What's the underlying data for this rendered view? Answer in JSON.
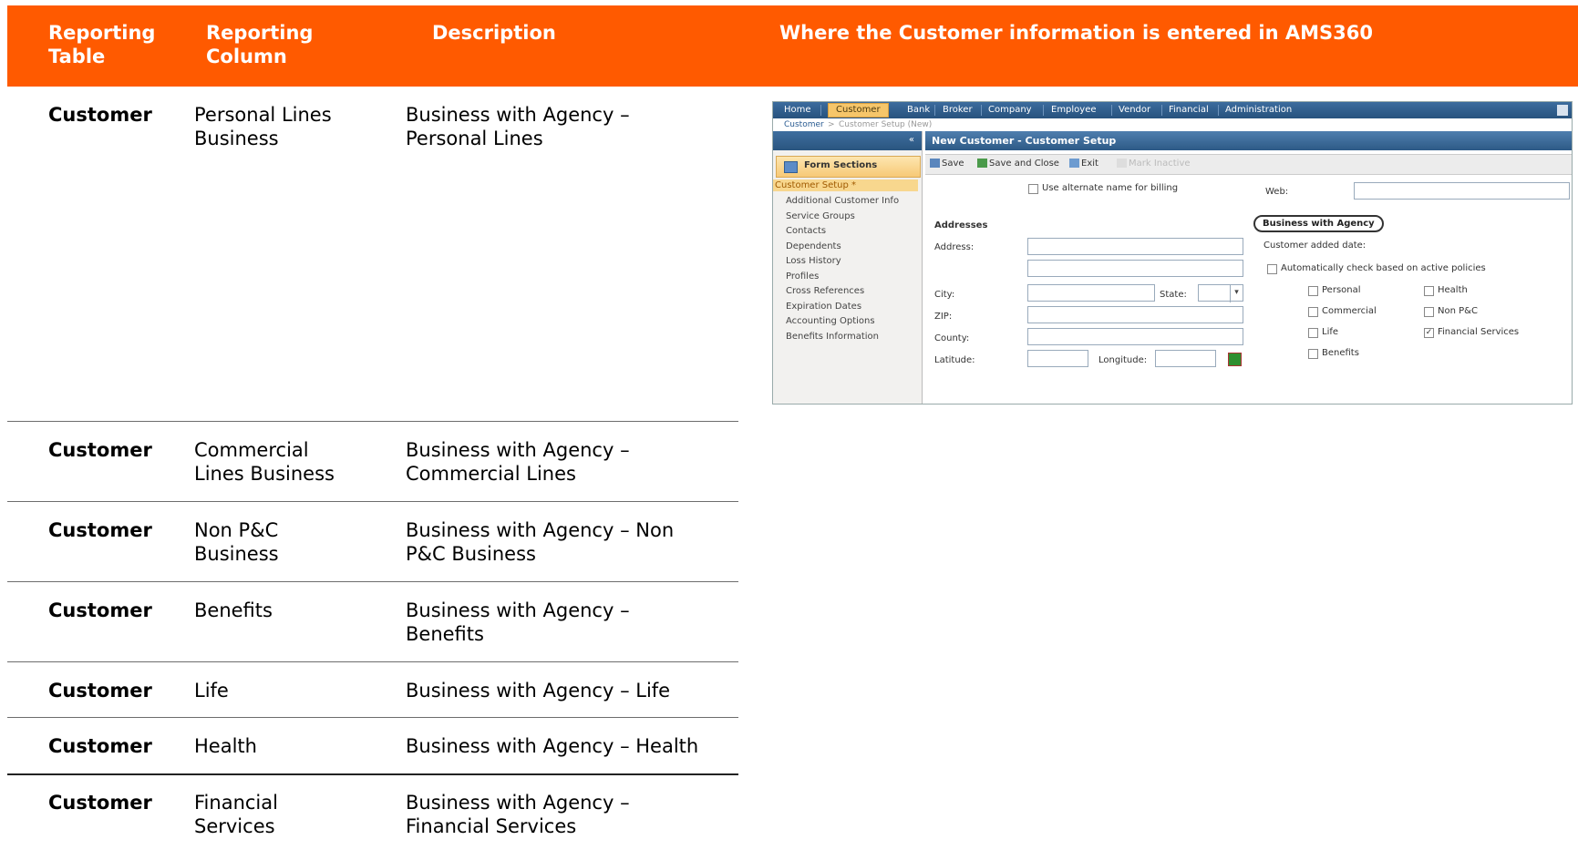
{
  "header": {
    "col1": "Reporting Table",
    "col2": "Reporting Column",
    "col3": "Description",
    "col4": "Where the Customer information is entered in AMS360"
  },
  "rows": [
    {
      "table": "Customer",
      "column": "Personal Lines Business",
      "description": "Business with Agency – Personal Lines"
    },
    {
      "table": "Customer",
      "column": "Commercial Lines Business",
      "description": "Business with Agency – Commercial Lines"
    },
    {
      "table": "Customer",
      "column": "Non P&C Business",
      "description": "Business with Agency – Non P&C Business"
    },
    {
      "table": "Customer",
      "column": "Benefits",
      "description": "Business with Agency – Benefits"
    },
    {
      "table": "Customer",
      "column": "Life",
      "description": "Business with Agency – Life"
    },
    {
      "table": "Customer",
      "column": "Health",
      "description": "Business with Agency – Health"
    },
    {
      "table": "Customer",
      "column": "Financial Services",
      "description": "Business with Agency – Financial Services"
    }
  ],
  "colors": {
    "accent": "#FF5A00",
    "header_text": "#FFFFFF",
    "nav_blue": "#2D5A86",
    "active_tab": "#F6C66A"
  },
  "screenshot": {
    "nav": [
      "Home",
      "Customer",
      "Bank",
      "Broker",
      "Company",
      "Employee",
      "Vendor",
      "Financial",
      "Administration"
    ],
    "breadcrumb": [
      "Customer",
      "Customer Setup (New)"
    ],
    "form_sections_label": "Form Sections",
    "left_items": [
      "Customer Setup *",
      "Additional Customer Info",
      "Service Groups",
      "Contacts",
      "Dependents",
      "Loss History",
      "Profiles",
      "Cross References",
      "Expiration Dates",
      "Accounting Options",
      "Benefits Information"
    ],
    "title": "New Customer - Customer Setup",
    "toolbar": [
      "Save",
      "Save and Close",
      "Exit",
      "Mark Inactive"
    ],
    "alt_name_label": "Use alternate name for billing",
    "web_label": "Web:",
    "addresses_label": "Addresses",
    "address_label": "Address:",
    "city_label": "City:",
    "state_label": "State:",
    "zip_label": "ZIP:",
    "county_label": "County:",
    "latitude_label": "Latitude:",
    "longitude_label": "Longitude:",
    "bwa_label": "Business with Agency",
    "added_date_label": "Customer added date:",
    "auto_check_label": "Automatically check based on active policies",
    "checkboxes": [
      "Personal",
      "Health",
      "Commercial",
      "Non P&C",
      "Life",
      "Financial Services",
      "Benefits"
    ],
    "checked": [
      "Financial Services"
    ]
  }
}
